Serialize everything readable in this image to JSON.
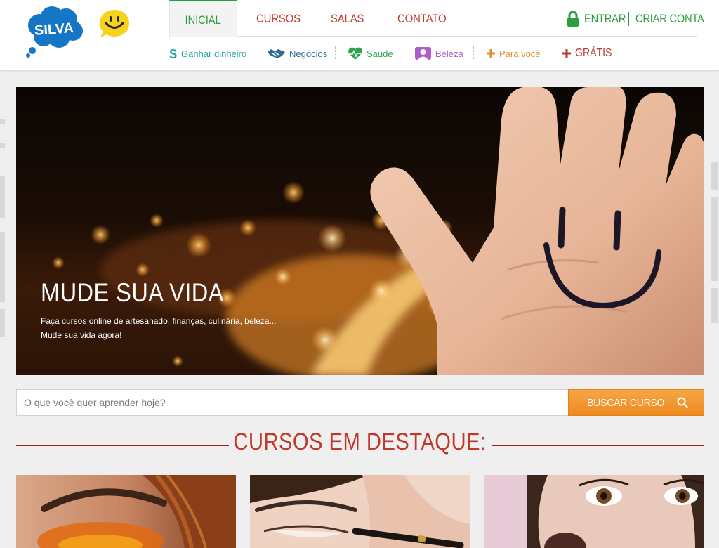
{
  "brand": {
    "logo_text": "SILVA"
  },
  "nav": {
    "tabs": [
      {
        "label": "INICIAL"
      },
      {
        "label": "CURSOS"
      },
      {
        "label": "SALAS"
      },
      {
        "label": "CONTATO"
      }
    ],
    "account": {
      "login": "ENTRAR",
      "register": "CRIAR CONTA"
    }
  },
  "categories": [
    {
      "label": "Ganhar dinheiro",
      "icon": "dollar-icon",
      "color": "#26a6a0"
    },
    {
      "label": "Negócios",
      "icon": "handshake-icon",
      "color": "#2f6d95"
    },
    {
      "label": "Saúde",
      "icon": "heart-pulse-icon",
      "color": "#2ea44f"
    },
    {
      "label": "Beleza",
      "icon": "beauty-icon",
      "color": "#b05cc8"
    },
    {
      "label": "Para você",
      "icon": "plus-icon",
      "color": "#e58a2f"
    },
    {
      "label": "GRÁTIS",
      "icon": "plus-icon",
      "color": "#b83a30"
    }
  ],
  "hero": {
    "title": "MUDE SUA VIDA",
    "subtitle_line1": "Faça cursos online de artesanado, finanças, culinária, beleza...",
    "subtitle_line2": "Mude sua vida agora!"
  },
  "search": {
    "placeholder": "O que você quer aprender hoje?",
    "button": "BUSCAR CURSO"
  },
  "featured": {
    "title": "CURSOS EM DESTAQUE:",
    "cards": [
      {
        "image": "orange-eyeshadow-photo"
      },
      {
        "image": "eyeliner-photo"
      },
      {
        "image": "makeup-brush-photo"
      }
    ]
  },
  "colors": {
    "green": "#2e9b3e",
    "red": "#c0392b",
    "orange": "#ee8a20",
    "logo_blue": "#1576c6",
    "smiley_yellow": "#f7d21b"
  }
}
